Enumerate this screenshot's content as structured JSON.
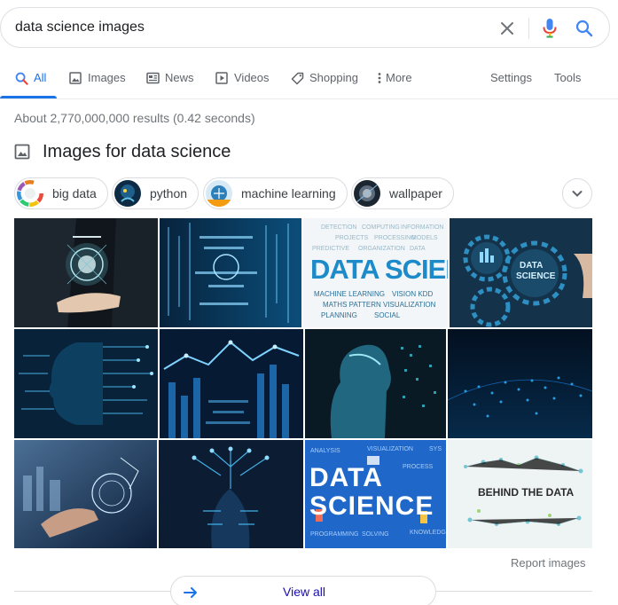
{
  "search": {
    "query": "data science images"
  },
  "tabs": [
    {
      "label": "All",
      "icon": "search-icon",
      "active": true
    },
    {
      "label": "Images",
      "icon": "image-icon"
    },
    {
      "label": "News",
      "icon": "news-icon"
    },
    {
      "label": "Videos",
      "icon": "play-icon"
    },
    {
      "label": "Shopping",
      "icon": "tag-icon"
    },
    {
      "label": "More",
      "icon": "more-vert-icon"
    }
  ],
  "tools": {
    "settings": "Settings",
    "tools": "Tools"
  },
  "result_stats": "About 2,770,000,000 results (0.42 seconds)",
  "images_section": {
    "title": "Images for data science",
    "chips": [
      "big data",
      "python",
      "machine learning",
      "wallpaper"
    ],
    "tiles": {
      "tile3_text": "DATA SCIEN",
      "tile4_text1": "DATA",
      "tile4_text2": "SCIENCE",
      "tile11_text1": "DATA",
      "tile11_text2": "SCIENCE",
      "tile12_text": "BEHIND THE DATA"
    },
    "report": "Report images",
    "view_all": "View all"
  },
  "colors": {
    "accent": "#1a73e8",
    "link": "#1a0dab",
    "muted": "#70757a",
    "border": "#dadce0"
  }
}
